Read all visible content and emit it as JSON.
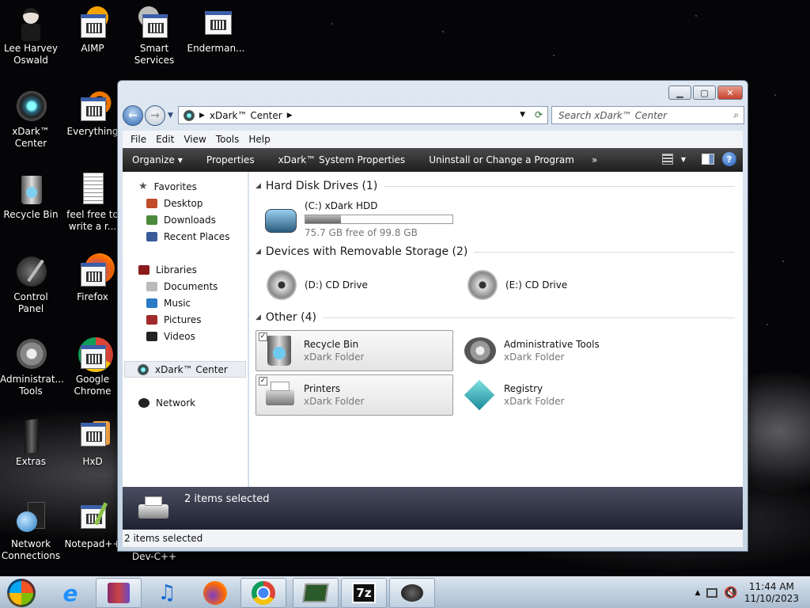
{
  "desktop": {
    "icons": [
      {
        "label": "Lee Harvey Oswald",
        "icon": "person-icon"
      },
      {
        "label": "AIMP",
        "icon": "aimp-icon"
      },
      {
        "label": "Smart Services",
        "icon": "gear-app-icon"
      },
      {
        "label": "Enderman...",
        "icon": "enderman-icon"
      },
      {
        "label": "xDark™ Center",
        "icon": "xdark-center-icon"
      },
      {
        "label": "Everything",
        "icon": "everything-icon"
      },
      {
        "label": "Recycle Bin",
        "icon": "recycle-bin-icon"
      },
      {
        "label": "feel free to write a r...",
        "icon": "text-document-icon"
      },
      {
        "label": "Control Panel",
        "icon": "control-panel-icon"
      },
      {
        "label": "Firefox",
        "icon": "firefox-icon"
      },
      {
        "label": "Administrat... Tools",
        "icon": "admin-tools-icon"
      },
      {
        "label": "Google Chrome",
        "icon": "chrome-icon"
      },
      {
        "label": "Extras",
        "icon": "extras-icon"
      },
      {
        "label": "HxD",
        "icon": "hxd-icon"
      },
      {
        "label": "Network Connections",
        "icon": "network-connections-icon"
      },
      {
        "label": "Notepad++",
        "icon": "notepad-plus-plus-icon"
      },
      {
        "label": "Dev-C++",
        "icon": "devcpp-icon"
      }
    ]
  },
  "window": {
    "address": "xDark™ Center",
    "search_placeholder": "Search xDark™ Center",
    "menu": [
      "File",
      "Edit",
      "View",
      "Tools",
      "Help"
    ],
    "commands": [
      "Organize",
      "Properties",
      "xDark™ System Properties",
      "Uninstall or Change a Program",
      "»"
    ],
    "nav": {
      "favorites": "Favorites",
      "favorites_items": [
        "Desktop",
        "Downloads",
        "Recent Places"
      ],
      "libraries": "Libraries",
      "libraries_items": [
        "Documents",
        "Music",
        "Pictures",
        "Videos"
      ],
      "selected": "xDark™ Center",
      "network": "Network"
    },
    "groups": {
      "hdd": "Hard Disk Drives (1)",
      "removable": "Devices with Removable Storage (2)",
      "other": "Other (4)"
    },
    "drives": {
      "c_name": "(C:) xDark HDD",
      "c_free": "75.7 GB free of 99.8 GB",
      "c_used_fraction": 0.24,
      "d_name": "(D:) CD Drive",
      "e_name": "(E:) CD Drive"
    },
    "other_items": [
      {
        "name": "Recycle Bin",
        "type": "xDark Folder",
        "selected": true
      },
      {
        "name": "Administrative Tools",
        "type": "xDark Folder",
        "selected": false
      },
      {
        "name": "Printers",
        "type": "xDark Folder",
        "selected": true
      },
      {
        "name": "Registry",
        "type": "xDark Folder",
        "selected": false
      }
    ],
    "details_text": "2 items selected",
    "status_text": "2 items selected"
  },
  "taskbar": {
    "time": "11:44 AM",
    "date": "11/10/2023",
    "apps": [
      "start-orb-icon",
      "internet-explorer-icon",
      "winrar-icon",
      "itunes-icon",
      "firefox-icon",
      "chrome-icon",
      "task-manager-icon",
      "7zip-icon",
      "xdark-icon"
    ]
  }
}
